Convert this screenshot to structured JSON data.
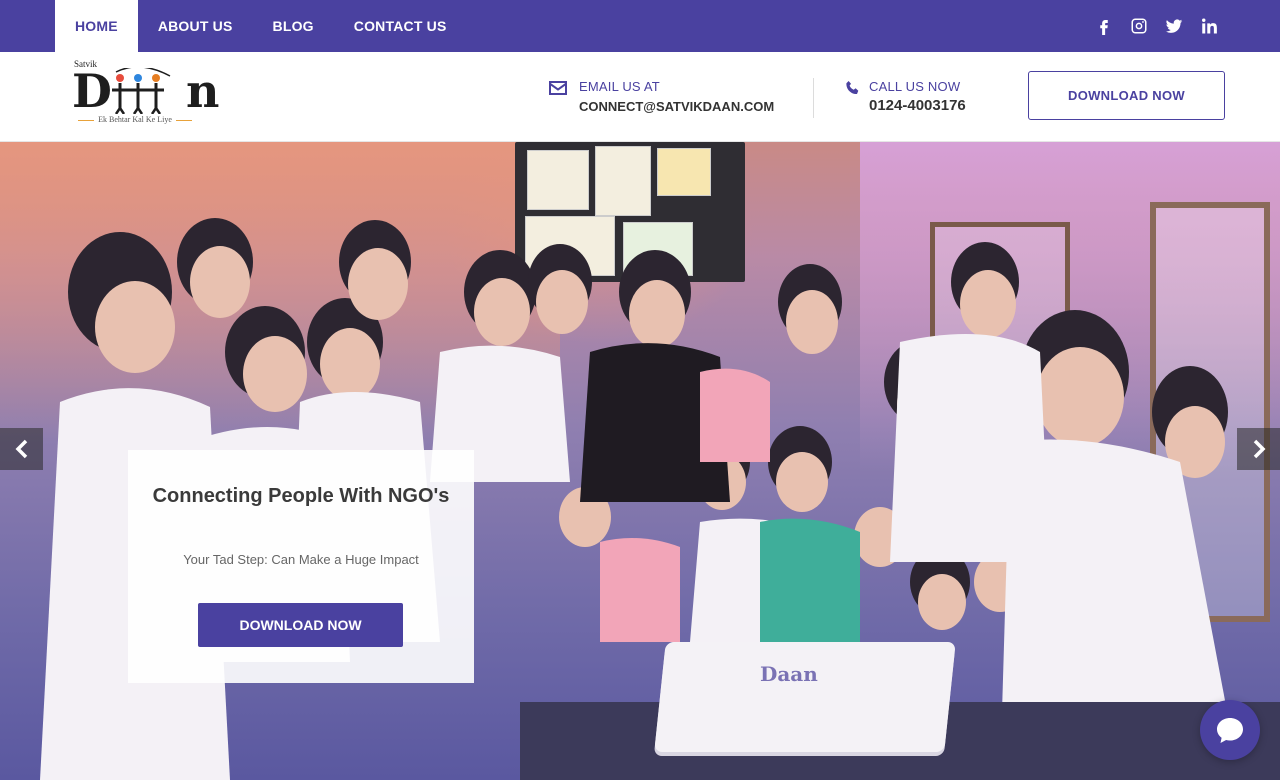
{
  "nav": {
    "items": [
      {
        "label": "HOME",
        "active": true
      },
      {
        "label": "ABOUT US",
        "active": false
      },
      {
        "label": "BLOG",
        "active": false
      },
      {
        "label": "CONTACT US",
        "active": false
      }
    ],
    "social_icons": [
      "facebook-icon",
      "instagram-icon",
      "twitter-icon",
      "linkedin-icon"
    ]
  },
  "header": {
    "logo": {
      "small_text": "Satvik",
      "word": "Daan",
      "tagline": "Ek Behtar Kal Ke Liye"
    },
    "email": {
      "label": "EMAIL US AT",
      "value": "CONNECT@SATVIKDAAN.COM",
      "icon": "envelope-icon"
    },
    "phone": {
      "label": "CALL US NOW",
      "value": "0124-4003176",
      "icon": "phone-icon"
    },
    "download_label": "DOWNLOAD NOW"
  },
  "hero": {
    "title": "Connecting People With NGO's",
    "subtitle": "Your Tad Step: Can Make a Huge Impact",
    "button_label": "DOWNLOAD NOW",
    "cake_text": "Daan"
  },
  "colors": {
    "brand": "#4a41a0",
    "white": "#ffffff",
    "text_dark": "#3a3a3a"
  }
}
